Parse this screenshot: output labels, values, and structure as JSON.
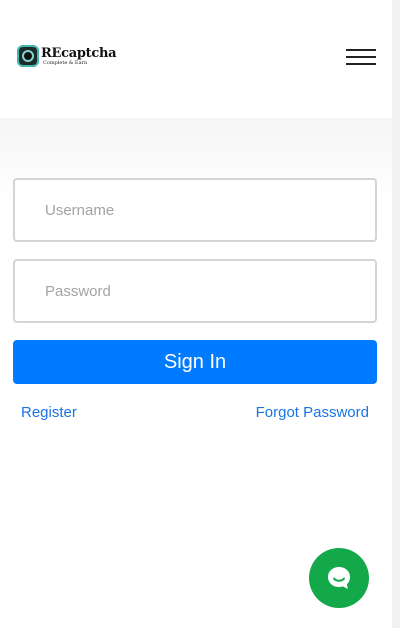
{
  "brand": {
    "name": "REcaptcha",
    "tagline": "Complete & Earn"
  },
  "login": {
    "username_placeholder": "Username",
    "password_placeholder": "Password",
    "signin_label": "Sign In",
    "register_label": "Register",
    "forgot_label": "Forgot Password"
  },
  "icons": {
    "menu": "hamburger-menu-icon",
    "chat": "chat-bubble-icon"
  },
  "colors": {
    "primary_button": "#007bff",
    "link": "#1a73e8",
    "chat": "#13a94a"
  }
}
